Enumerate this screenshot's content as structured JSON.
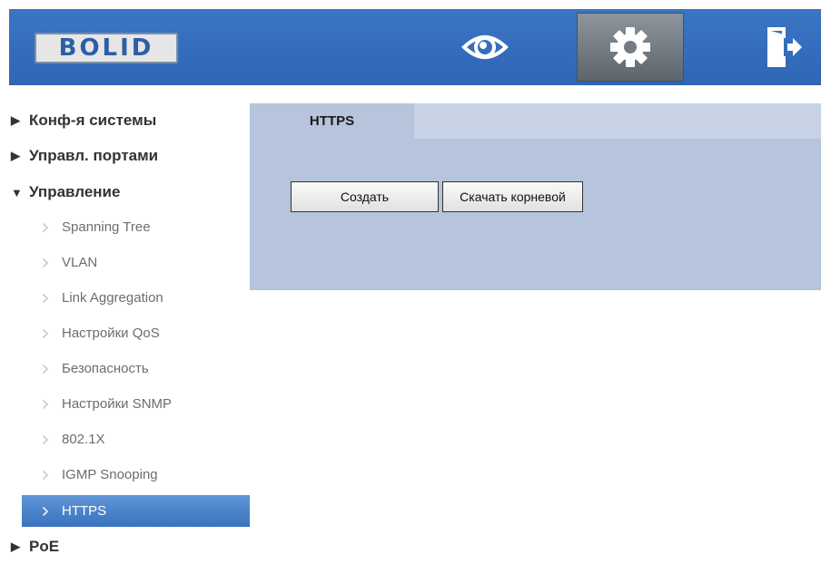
{
  "header": {
    "logo_text": "BOLID",
    "nav": [
      {
        "icon": "eye-icon"
      },
      {
        "icon": "gear-icon",
        "active": true
      },
      {
        "icon": "exit-icon"
      }
    ]
  },
  "sidebar": {
    "groups": [
      {
        "label": "Конф-я системы",
        "expanded": false
      },
      {
        "label": "Управл. портами",
        "expanded": false
      },
      {
        "label": "Управление",
        "expanded": true
      },
      {
        "label": "PoE",
        "expanded": false
      }
    ],
    "items": [
      {
        "label": "Spanning Tree"
      },
      {
        "label": "VLAN"
      },
      {
        "label": "Link Aggregation"
      },
      {
        "label": "Настройки QoS"
      },
      {
        "label": "Безопасность"
      },
      {
        "label": "Настройки SNMP"
      },
      {
        "label": "802.1X"
      },
      {
        "label": "IGMP Snooping"
      },
      {
        "label": "HTTPS",
        "active": true
      }
    ]
  },
  "main": {
    "tab_label": "HTTPS",
    "create_button": "Создать",
    "download_button": "Скачать корневой"
  },
  "colors": {
    "header": "#2f66b4",
    "panel": "#b6c4dc",
    "active_item": "#3a72bf"
  }
}
